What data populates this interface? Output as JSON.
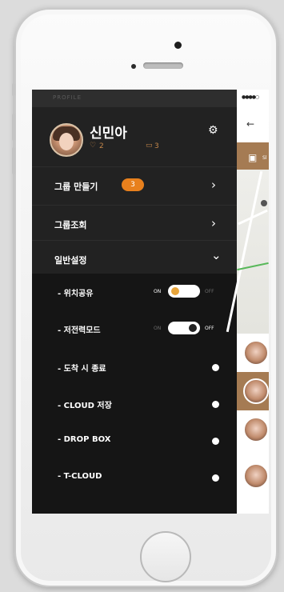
{
  "drawer": {
    "header_label": "PROFILE",
    "user": {
      "name": "신민아",
      "hearts": "2",
      "comments": "3"
    },
    "menu": [
      {
        "label": "그룹 만들기",
        "badge": "3"
      },
      {
        "label": "그룹조회"
      },
      {
        "label": "일반설정"
      }
    ],
    "settings": [
      {
        "label": "- 위치공유",
        "type": "toggle",
        "on_label": "ON",
        "off_label": "OFF",
        "state": "on"
      },
      {
        "label": "- 저전력모드",
        "type": "toggle",
        "on_label": "ON",
        "off_label": "OFF",
        "state": "off"
      },
      {
        "label": "- 도착 시 종료",
        "type": "dot"
      },
      {
        "label": "- CLOUD 저장",
        "type": "dot"
      },
      {
        "label": "- DROP BOX",
        "type": "dot"
      },
      {
        "label": "- T-CLOUD",
        "type": "dot"
      }
    ]
  },
  "preview": {
    "status": "●●●●○",
    "bar_text": "Sl"
  },
  "colors": {
    "accent": "#e8801d",
    "drawer_bg": "#222222",
    "panel_bg": "#151515",
    "brand_brown": "#a57b53"
  }
}
